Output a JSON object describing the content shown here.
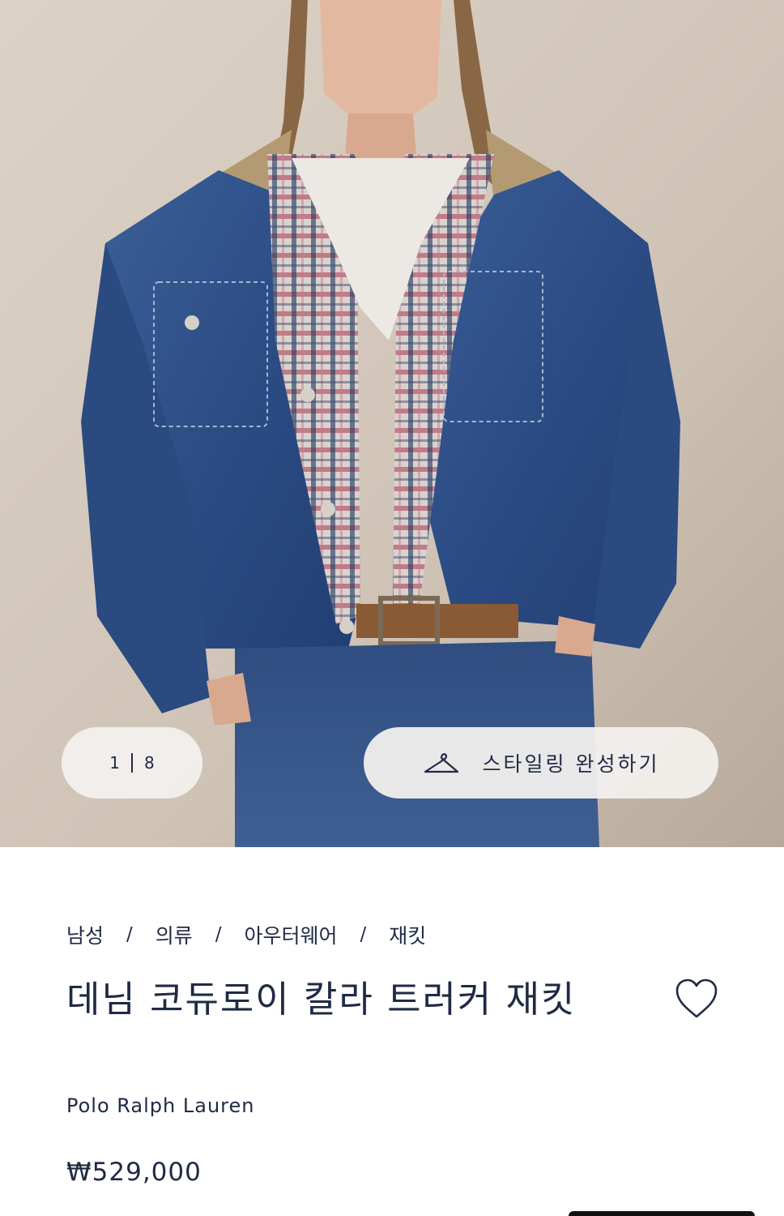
{
  "gallery": {
    "current_index": "1",
    "total_count": "8",
    "styling_label": "스타일링 완성하기",
    "styling_icon": "hanger-icon"
  },
  "breadcrumb": {
    "items": [
      "남성",
      "의류",
      "아우터웨어",
      "재킷"
    ],
    "separator": "/"
  },
  "product": {
    "title": "데님 코듀로이 칼라 트러커 재킷",
    "brand": "Polo Ralph Lauren",
    "price": "₩529,000",
    "wishlist_icon": "heart-outline-icon"
  },
  "colors": {
    "text": "#1f2a44",
    "pill_background": "#f2f0ed",
    "denim": "#2f4f86"
  }
}
